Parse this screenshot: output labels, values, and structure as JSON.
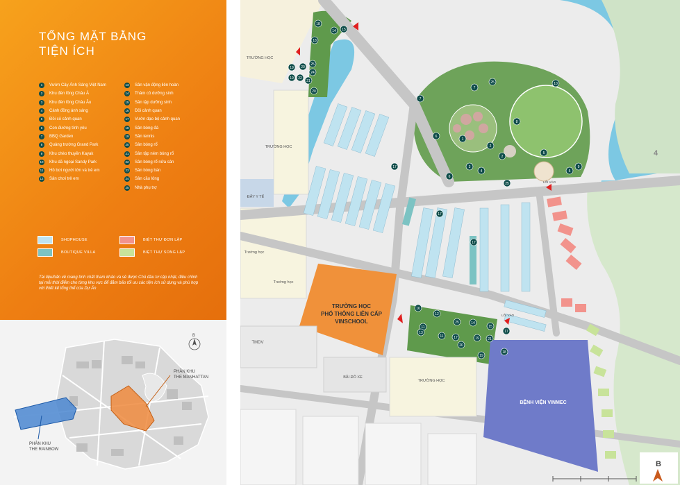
{
  "title_lines": [
    "TỔNG MẶT BẰNG",
    "TIỆN ÍCH"
  ],
  "legend_col1": [
    {
      "n": "1",
      "label": "Vườn Cây Ánh Sáng Việt Nam"
    },
    {
      "n": "2",
      "label": "Khu đèn lồng Châu Á"
    },
    {
      "n": "3",
      "label": "Khu đèn lồng Châu Âu"
    },
    {
      "n": "4",
      "label": "Cánh đồng ánh sáng"
    },
    {
      "n": "5",
      "label": "Đồi cỏ cảnh quan"
    },
    {
      "n": "6",
      "label": "Con đường tình yêu"
    },
    {
      "n": "7",
      "label": "BBQ Garden"
    },
    {
      "n": "8",
      "label": "Quảng trường Grand Park"
    },
    {
      "n": "9",
      "label": "Khu chèo thuyền Kayak"
    },
    {
      "n": "10",
      "label": "Khu dã ngoại Sandy Park"
    },
    {
      "n": "11",
      "label": "Hồ bơi người lớn và trẻ em"
    },
    {
      "n": "12",
      "label": "Sân chơi trẻ em"
    }
  ],
  "legend_col2": [
    {
      "n": "13",
      "label": "Sân vận động liên hoàn"
    },
    {
      "n": "14",
      "label": "Thảm cỏ dưỡng sinh"
    },
    {
      "n": "15",
      "label": "Sân tập dưỡng sinh"
    },
    {
      "n": "16",
      "label": "Đồi cảnh quan"
    },
    {
      "n": "17",
      "label": "Vườn dạo bộ cảnh quan"
    },
    {
      "n": "18",
      "label": "Sân bóng đá"
    },
    {
      "n": "19",
      "label": "Sân tennis"
    },
    {
      "n": "20",
      "label": "Sân bóng rổ"
    },
    {
      "n": "21",
      "label": "Sân tập ném bóng rổ"
    },
    {
      "n": "22",
      "label": "Sân bóng rổ nửa sân"
    },
    {
      "n": "23",
      "label": "Sân bóng bàn"
    },
    {
      "n": "24",
      "label": "Sân cầu lông"
    },
    {
      "n": "25",
      "label": "Nhà phụ trợ"
    }
  ],
  "property_types": [
    {
      "label": "SHOPHOUSE",
      "color": "#bfe3f0"
    },
    {
      "label": "BOUTIQUE VILLA",
      "color": "#7cc3c3"
    },
    {
      "label": "BIỆT THỰ ĐƠN LẬP",
      "color": "#f2938c"
    },
    {
      "label": "BIỆT THỰ SONG LẬP",
      "color": "#c8e39a"
    }
  ],
  "disclaimer": "Tài liệu/bản vẽ mang tính chất tham khảo và sẽ được Chủ đầu tư cập nhật, điều chỉnh tại mỗi thời điểm cho từng khu vực để đảm bảo tối ưu các tiện ích sử dụng và phù hợp với thiết kế tổng thể của Dự Án",
  "minimap": {
    "compass": "B",
    "manhattan_line1": "PHÂN KHU",
    "manhattan_line2": "THE MANHATTAN",
    "rainbow_line1": "PHÂN KHU",
    "rainbow_line2": "THE RAINBOW"
  },
  "map_labels": {
    "truong_hoc": "TRƯỜNG HỌC",
    "truong_hoc_mixed": "Trường học",
    "day_y_te": "ĐẤY Y TẾ",
    "vinschool_1": "TRƯỜNG HỌC",
    "vinschool_2": "PHỔ THÔNG LIÊN CẤP",
    "vinschool_3": "VINSCHOOL",
    "tmdv": "TMDV",
    "bai_do_xe": "BÃI ĐỖ XE",
    "vinmec": "BỆNH VIỆN VINMEC",
    "loi_vao": "LỐI VÀO",
    "zone_number": "4",
    "compass": "B"
  },
  "colors": {
    "orange_panel": "#ee7e12",
    "legend_badge": "#0e4c49",
    "water": "#7cc8e3",
    "park_green": "#6ea35a",
    "road": "#cfcfcf",
    "vinschool": "#f0913a",
    "vinmec": "#6f7bc9",
    "entry_marker": "#e02020"
  }
}
